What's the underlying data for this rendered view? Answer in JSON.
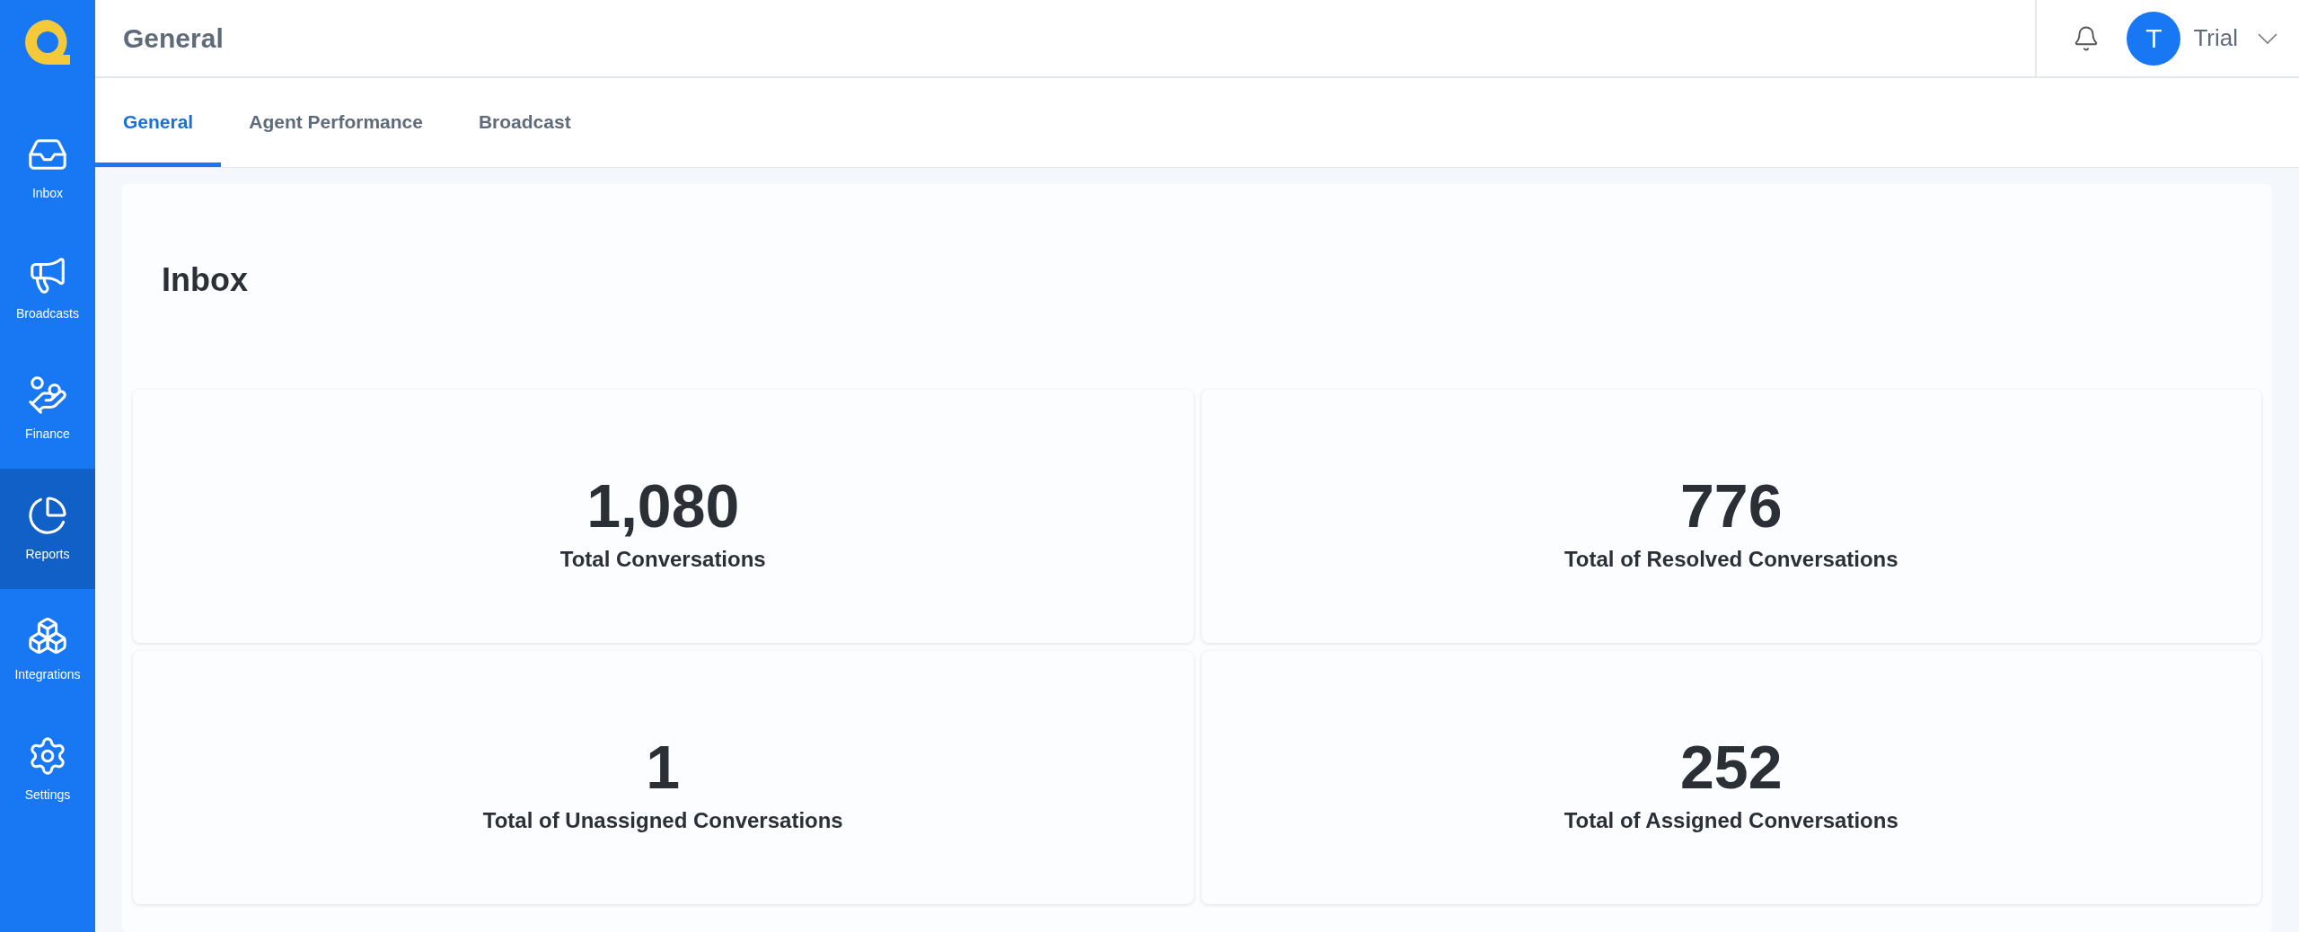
{
  "sidebar": {
    "items": [
      {
        "kind": "inbox",
        "label": "Inbox",
        "selected": false
      },
      {
        "kind": "broadcasts",
        "label": "Broadcasts",
        "selected": false
      },
      {
        "kind": "finance",
        "label": "Finance",
        "selected": false
      },
      {
        "kind": "reports",
        "label": "Reports",
        "selected": true
      },
      {
        "kind": "integrations",
        "label": "Integrations",
        "selected": false
      },
      {
        "kind": "settings",
        "label": "Settings",
        "selected": false
      }
    ]
  },
  "header": {
    "title": "General",
    "user": {
      "initial": "T",
      "name": "Trial"
    }
  },
  "tabs": [
    {
      "label": "General",
      "selected": true
    },
    {
      "label": "Agent Performance",
      "selected": false
    },
    {
      "label": "Broadcast",
      "selected": false
    }
  ],
  "panel": {
    "title": "Inbox",
    "stats": [
      {
        "value": "1,080",
        "label": "Total Conversations"
      },
      {
        "value": "776",
        "label": "Total of Resolved Conversations"
      },
      {
        "value": "1",
        "label": "Total of Unassigned Conversations"
      },
      {
        "value": "252",
        "label": "Total of Assigned Conversations"
      }
    ]
  }
}
